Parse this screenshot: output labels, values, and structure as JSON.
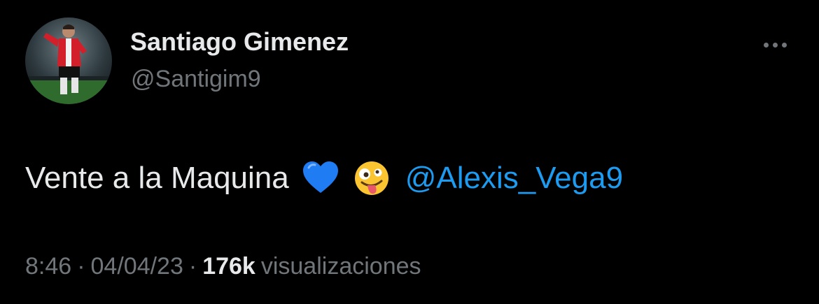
{
  "tweet": {
    "author": {
      "display_name": "Santiago Gimenez",
      "handle": "@Santigim9",
      "avatar_icon": "player-photo-avatar"
    },
    "more_icon": "more-dots-icon",
    "text": "Vente a la Maquina",
    "emojis": [
      "blue-heart-emoji",
      "zany-face-emoji"
    ],
    "mention": "@Alexis_Vega9",
    "time": "8:46",
    "separator": "·",
    "date": "04/04/23",
    "views_count": "176k",
    "views_label": "visualizaciones"
  },
  "colors": {
    "background": "#000000",
    "primary_text": "#e7e9ea",
    "secondary_text": "#71767b",
    "link": "#1d9bf0",
    "heart": "#1f7cf2"
  }
}
